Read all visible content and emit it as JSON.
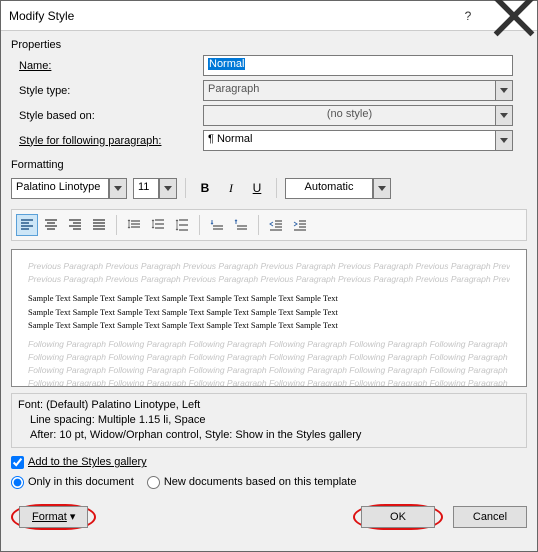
{
  "window": {
    "title": "Modify Style"
  },
  "sections": {
    "properties": "Properties",
    "formatting": "Formatting"
  },
  "props": {
    "name_label": "Name:",
    "name_value": "Normal",
    "type_label": "Style type:",
    "type_value": "Paragraph",
    "based_label": "Style based on:",
    "based_value": "(no style)",
    "following_label": "Style for following paragraph:",
    "following_value": "¶ Normal"
  },
  "formatting": {
    "font_name": "Palatino Linotype",
    "font_size": "11",
    "bold": "B",
    "italic": "I",
    "underline": "U",
    "color": "Automatic"
  },
  "preview": {
    "ghost_prev": "Previous Paragraph Previous Paragraph Previous Paragraph Previous Paragraph Previous Paragraph Previous Paragraph Previous Paragraph Previous Paragraph Previous Paragraph",
    "sample": "Sample Text Sample Text Sample Text Sample Text Sample Text Sample Text Sample Text",
    "ghost_next": "Following Paragraph Following Paragraph Following Paragraph Following Paragraph Following Paragraph Following Paragraph Following Paragraph Following Paragraph Following Paragraph"
  },
  "description": {
    "line1": "Font: (Default) Palatino Linotype, Left",
    "line2": "Line spacing:  Multiple 1.15 li, Space",
    "line3": "After:  10 pt, Widow/Orphan control, Style: Show in the Styles gallery"
  },
  "options": {
    "add_gallery": "Add to the Styles gallery",
    "only_doc": "Only in this document",
    "new_docs": "New documents based on this template"
  },
  "buttons": {
    "format": "Format",
    "ok": "OK",
    "cancel": "Cancel"
  }
}
